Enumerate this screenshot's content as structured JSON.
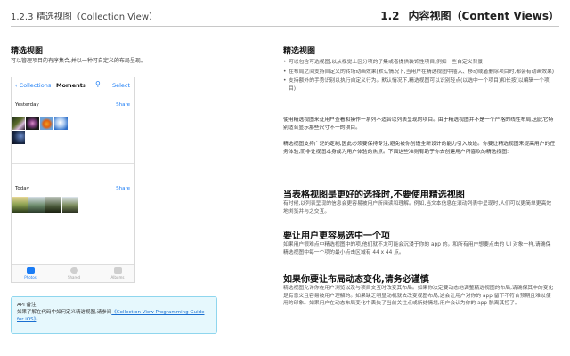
{
  "header": {
    "left_title": "1.2.3   精选视图（Collection View）",
    "right_number": "1.2",
    "right_title": "内容视图（Content Views）"
  },
  "left": {
    "title": "精选视图",
    "description": "可以管理项目的有序集合,并以一种可自定义的布局呈现。"
  },
  "phone": {
    "back_label": "Collections",
    "nav_title": "Moments",
    "search_glyph": "⚲",
    "select_label": "Select",
    "section1_label": "Yesterday",
    "section1_share": "Share",
    "section2_label": "Today",
    "section2_share": "Share",
    "tabs": [
      {
        "label": "Photos"
      },
      {
        "label": "Shared"
      },
      {
        "label": "Albums"
      }
    ]
  },
  "api_box": {
    "line1": "API 备注:",
    "line2_prefix": "如果了解在代码中如何定义精选视图,请参阅",
    "link": "《Collection View Programming Guide for iOS》",
    "suffix": "。"
  },
  "right": {
    "s1_title": "精选视图",
    "bullets": [
      "可以包含可选视图,以从视觉上区分项的子集或者提供装饰性项目,例如一些自定义背景",
      "在布局之间支持自定义的转场动画效果(默认情况下,当用户在精选视图中插入、移动或者删除项目时,都会有动画效果)",
      "支持额外的手势识别以执行自定义行为。默认情况下,精选视图可以识别轻点(以选中一个项目)和长按(以编辑一个项目)"
    ],
    "p1": "使用精选视图来让用户查看和操作一系列不适合以列表呈现的项目。由于精选视图并不是一个严格的线性布局,因此它特别适合显示那些尺寸不一的项目。",
    "p2": "精选视图支持广泛的定制,因此必须要保持专注,避免被你创造全新设计的能力引入歧途。你要让精选视图来提高用户的任务体验,而非让视图本身成为用户体验的焦点。下面这些准则有助于你去创建用户所喜欢的精选视图:",
    "s2_title": "当表格视图是更好的选择时,不要使用精选视图",
    "s2_text": "有时候,以列表呈现的信息会更容易被用户所阅读和理解。例如,当文本信息在滚动列表中呈现时,人们可以更简单更高效地浏览并与之交互。",
    "s3_title": "要让用户更容易选中一个项",
    "s3_text": "如果用户很难点中精选视图中的项,他们就不太可能会沉浸于你的 app 的。和所有用户想要点击的 UI 对象一样,请确保精选视图中每一个项的最小点击区域有 44 x 44 点。",
    "s4_title": "如果你要让布局动态变化,请务必谨慎",
    "s4_text": "精选视图允许你在用户浏览以及与项目交互时改变其布局。如果你决定要动态地调整精选视图的布局,请确保其中的变化是有意义且容易被用户理解的。如果缺乏明显动机就去改变视图布局,这会让用户对你的 app 留下不符合预期且难以使用的印象。如果用户在动态布局变化中丢失了当前关注点或所处情境,用户会认为你的 app 脱离其控了。"
  },
  "colors": {
    "accent": "#1a7cf5",
    "info_bg": "#e6f8fd",
    "info_border": "#8fd6ee"
  }
}
